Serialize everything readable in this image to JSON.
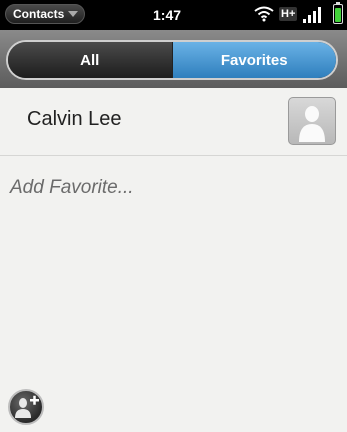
{
  "status_bar": {
    "app_menu_label": "Contacts",
    "app_menu_icon": "caret-down-icon",
    "time": "1:47",
    "network_label": "H+",
    "wifi_icon": "wifi-icon",
    "signal_icon": "signal-bars-icon",
    "battery_icon": "battery-icon",
    "battery_level": 0.85,
    "battery_color": "#43d33a"
  },
  "tabs": [
    {
      "label": "All",
      "selected": false
    },
    {
      "label": "Favorites",
      "selected": true
    }
  ],
  "accent_color": "#3d8ccc",
  "favorites": [
    {
      "name": "Calvin Lee",
      "avatar_icon": "person-silhouette-icon"
    }
  ],
  "add_favorite_label": "Add Favorite...",
  "add_contact_button_icon": "add-person-icon"
}
